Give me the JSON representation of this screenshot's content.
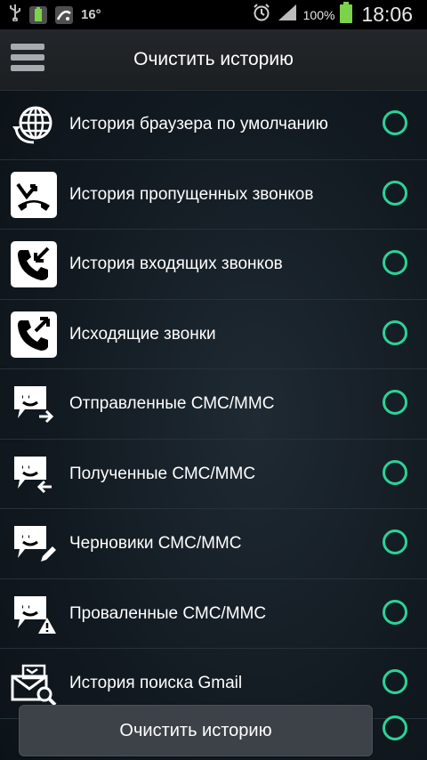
{
  "status_bar": {
    "temperature": "16°",
    "battery_percent": "100%",
    "time": "18:06",
    "icons": [
      "usb-icon",
      "battery-notification-icon",
      "weather-icon",
      "alarm-icon",
      "signal-icon",
      "battery-icon"
    ]
  },
  "header": {
    "title": "Очистить историю",
    "menu_icon": "hamburger-menu-icon"
  },
  "items": [
    {
      "label": "История браузера по умолчанию",
      "icon": "globe-icon",
      "selected": false
    },
    {
      "label": "История пропущенных звонков",
      "icon": "missed-call-icon",
      "selected": false
    },
    {
      "label": "История входящих звонков",
      "icon": "incoming-call-icon",
      "selected": false
    },
    {
      "label": "Исходящие звонки",
      "icon": "outgoing-call-icon",
      "selected": false
    },
    {
      "label": "Отправленные СМС/MMC",
      "icon": "sent-message-icon",
      "selected": false
    },
    {
      "label": "Полученные СМС/MMC",
      "icon": "received-message-icon",
      "selected": false
    },
    {
      "label": "Черновики СМС/MMC",
      "icon": "draft-message-icon",
      "selected": false
    },
    {
      "label": "Проваленные СМС/MMC",
      "icon": "failed-message-icon",
      "selected": false
    },
    {
      "label": "История поиска Gmail",
      "icon": "mail-search-icon",
      "selected": false
    }
  ],
  "footer": {
    "clear_button_label": "Очистить историю",
    "select_all_selected": false
  },
  "colors": {
    "accent": "#2ed196",
    "header_bg": "#1f2327",
    "button_bg": "#3c4247"
  }
}
